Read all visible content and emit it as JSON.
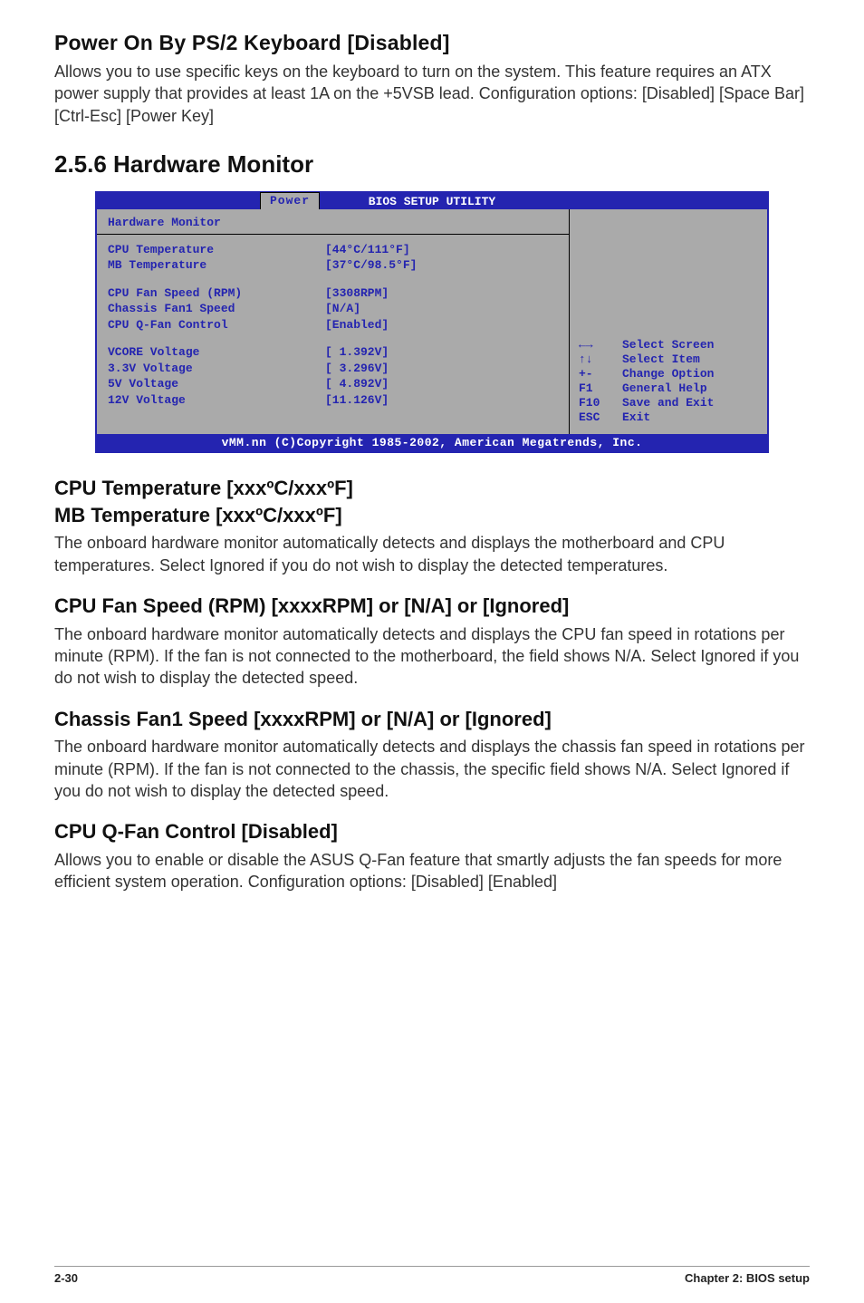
{
  "section_power_on": {
    "heading": "Power On By PS/2 Keyboard [Disabled]",
    "body": "Allows you to use specific keys on the keyboard to turn on the system. This feature requires an ATX power supply that provides at least 1A on the +5VSB lead. Configuration options: [Disabled] [Space Bar] [Ctrl-Esc] [Power Key]"
  },
  "section_hw_monitor": {
    "heading": "2.5.6   Hardware Monitor"
  },
  "bios": {
    "title": "BIOS SETUP UTILITY",
    "tab": "Power",
    "panel_title": "Hardware Monitor",
    "rows": [
      {
        "label": "CPU Temperature",
        "value": "[44°C/111°F]"
      },
      {
        "label": "MB Temperature",
        "value": "[37°C/98.5°F]"
      }
    ],
    "rows2": [
      {
        "label": "CPU Fan Speed (RPM)",
        "value": "[3308RPM]"
      },
      {
        "label": "Chassis Fan1 Speed",
        "value": "[N/A]"
      },
      {
        "label": "CPU Q-Fan Control",
        "value": "[Enabled]"
      }
    ],
    "rows3": [
      {
        "label": "VCORE Voltage",
        "value": "[ 1.392V]"
      },
      {
        "label": "3.3V Voltage",
        "value": "[ 3.296V]"
      },
      {
        "label": "5V Voltage",
        "value": "[ 4.892V]"
      },
      {
        "label": "12V Voltage",
        "value": "[11.126V]"
      }
    ],
    "help": [
      {
        "key": "←→",
        "text": "Select Screen"
      },
      {
        "key": "↑↓",
        "text": "Select Item"
      },
      {
        "key": "+-",
        "text": "Change Option"
      },
      {
        "key": "F1",
        "text": "General Help"
      },
      {
        "key": "F10",
        "text": "Save and Exit"
      },
      {
        "key": "ESC",
        "text": "Exit"
      }
    ],
    "copyright": "vMM.nn (C)Copyright 1985-2002, American Megatrends, Inc."
  },
  "section_cpu_temp": {
    "heading1": "CPU Temperature [xxxºC/xxxºF]",
    "heading2": "MB Temperature [xxxºC/xxxºF]",
    "body": "The onboard hardware monitor automatically detects and displays the motherboard and CPU temperatures. Select Ignored if you do not wish to display the detected temperatures."
  },
  "section_cpu_fan": {
    "heading": "CPU Fan Speed (RPM) [xxxxRPM] or [N/A] or [Ignored]",
    "body": "The onboard hardware monitor automatically detects and displays the CPU fan speed in rotations per minute (RPM). If the fan is not connected to the motherboard, the field shows N/A. Select Ignored if you do not wish to display the detected speed."
  },
  "section_chassis_fan": {
    "heading": "Chassis Fan1 Speed [xxxxRPM] or [N/A] or [Ignored]",
    "body": "The onboard hardware monitor automatically detects and displays the chassis fan speed in rotations per minute (RPM). If the fan is not connected to the chassis, the specific field shows N/A. Select Ignored if you do not wish to display the detected speed."
  },
  "section_qfan": {
    "heading": "CPU Q-Fan Control [Disabled]",
    "body": "Allows you to enable or disable the ASUS Q-Fan feature that smartly adjusts the fan speeds for more efficient system operation. Configuration options: [Disabled] [Enabled]"
  },
  "footer": {
    "left": "2-30",
    "right": "Chapter 2: BIOS setup"
  }
}
